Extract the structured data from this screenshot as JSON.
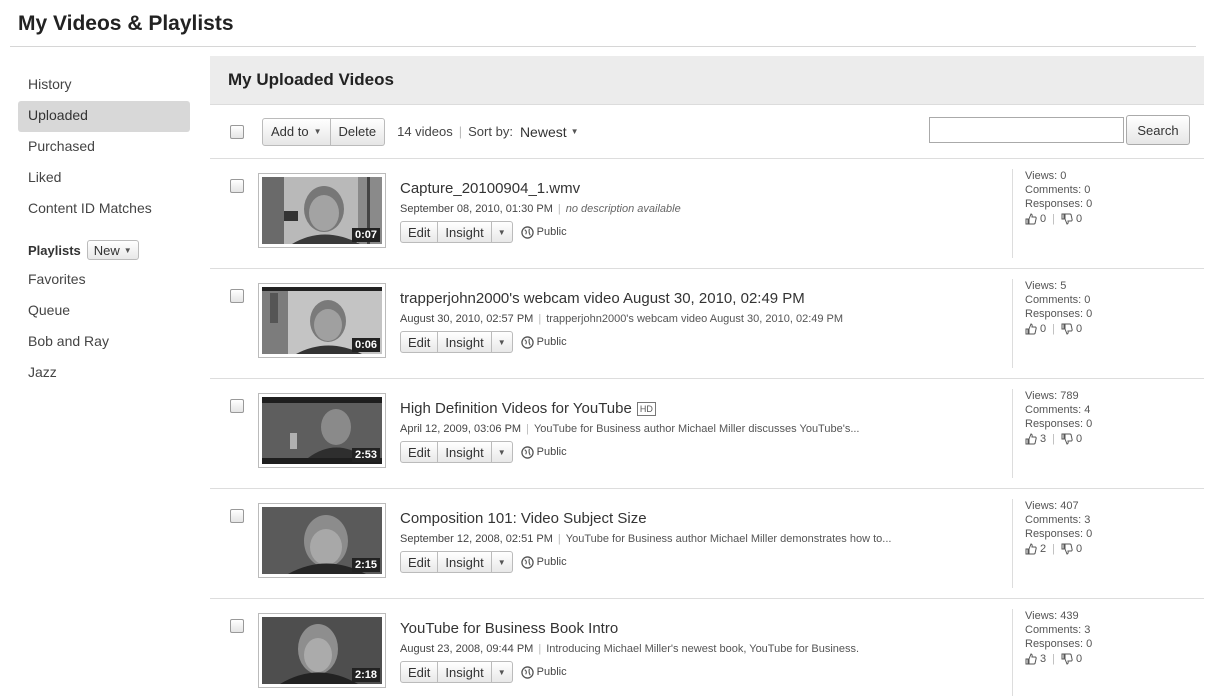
{
  "page_title": "My Videos & Playlists",
  "sidebar": {
    "items": [
      {
        "label": "History"
      },
      {
        "label": "Uploaded"
      },
      {
        "label": "Purchased"
      },
      {
        "label": "Liked"
      },
      {
        "label": "Content ID Matches"
      }
    ],
    "playlists_label": "Playlists",
    "new_label": "New",
    "playlists": [
      {
        "label": "Favorites"
      },
      {
        "label": "Queue"
      },
      {
        "label": "Bob and Ray"
      },
      {
        "label": "Jazz"
      }
    ]
  },
  "main": {
    "header": "My Uploaded Videos",
    "toolbar": {
      "add_to_label": "Add to",
      "delete_label": "Delete",
      "count_text": "14 videos",
      "sort_label": "Sort by:",
      "sort_value": "Newest",
      "search_placeholder": "",
      "search_label": "Search"
    },
    "edit_label": "Edit",
    "insight_label": "Insight",
    "public_label": "Public",
    "videos": [
      {
        "title": "Capture_20100904_1.wmv",
        "hd": "",
        "date": "September 08, 2010, 01:30 PM",
        "description": "no description available",
        "duration": "0:07",
        "views": "Views: 0",
        "comments": "Comments: 0",
        "responses": "Responses: 0",
        "likes": "0",
        "dislikes": "0"
      },
      {
        "title": "trapperjohn2000's webcam video August 30, 2010, 02:49 PM",
        "hd": "",
        "date": "August 30, 2010, 02:57 PM",
        "description": "trapperjohn2000's webcam video August 30, 2010, 02:49 PM",
        "duration": "0:06",
        "views": "Views: 5",
        "comments": "Comments: 0",
        "responses": "Responses: 0",
        "likes": "0",
        "dislikes": "0"
      },
      {
        "title": "High Definition Videos for YouTube",
        "hd": "HD",
        "date": "April 12, 2009, 03:06 PM",
        "description": "YouTube for Business author Michael Miller discusses YouTube's...",
        "duration": "2:53",
        "views": "Views: 789",
        "comments": "Comments: 4",
        "responses": "Responses: 0",
        "likes": "3",
        "dislikes": "0"
      },
      {
        "title": "Composition 101: Video Subject Size",
        "hd": "",
        "date": "September 12, 2008, 02:51 PM",
        "description": "YouTube for Business author Michael Miller demonstrates how to...",
        "duration": "2:15",
        "views": "Views: 407",
        "comments": "Comments: 3",
        "responses": "Responses: 0",
        "likes": "2",
        "dislikes": "0"
      },
      {
        "title": "YouTube for Business Book Intro",
        "hd": "",
        "date": "August 23, 2008, 09:44 PM",
        "description": "Introducing Michael Miller's newest book, YouTube for Business.",
        "duration": "2:18",
        "views": "Views: 439",
        "comments": "Comments: 3",
        "responses": "Responses: 0",
        "likes": "3",
        "dislikes": "0"
      }
    ]
  }
}
